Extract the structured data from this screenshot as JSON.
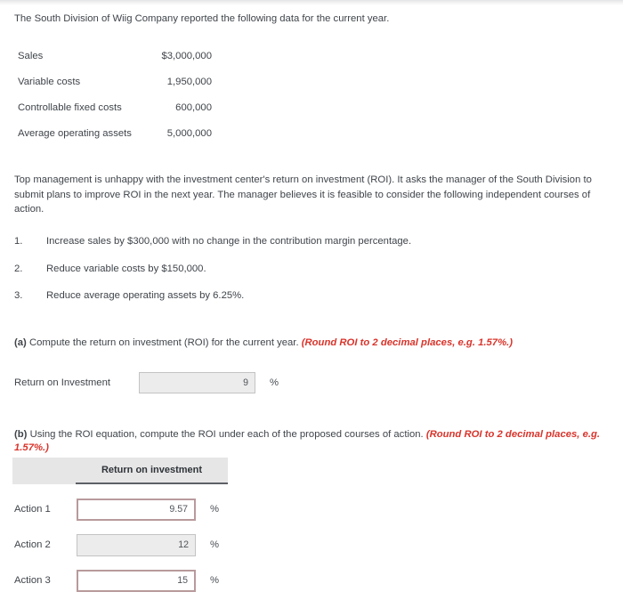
{
  "intro": {
    "text": "The South Division of Wiig Company reported the following data for the current year."
  },
  "financials": {
    "rows": [
      {
        "label": "Sales",
        "value": "$3,000,000"
      },
      {
        "label": "Variable costs",
        "value": "1,950,000"
      },
      {
        "label": "Controllable fixed costs",
        "value": "600,000"
      },
      {
        "label": "Average operating assets",
        "value": "5,000,000"
      }
    ]
  },
  "paragraph": {
    "text": "Top management is unhappy with the investment center's return on investment (ROI). It asks the manager of the South Division to submit plans to improve ROI in the next year. The manager believes it is feasible to consider the following independent courses of action."
  },
  "courses": [
    {
      "number": "1.",
      "text": "Increase sales by $300,000 with no change in the contribution margin percentage."
    },
    {
      "number": "2.",
      "text": "Reduce variable costs by $150,000."
    },
    {
      "number": "3.",
      "text": "Reduce average operating assets by 6.25%."
    }
  ],
  "part_a": {
    "marker": "(a)",
    "question": " Compute the return on investment (ROI) for the current year. ",
    "hint": "(Round ROI to 2 decimal places, e.g. 1.57%.)",
    "answer_label": "Return on Investment",
    "answer_value": "9",
    "percent_symbol": "%"
  },
  "part_b": {
    "marker": "(b)",
    "question": " Using the ROI equation, compute the ROI under each of the proposed courses of action. ",
    "hint": "(Round ROI to 2 decimal places, e.g. 1.57%.)",
    "table": {
      "column_header": "Return on investment",
      "rows": [
        {
          "label": "Action 1",
          "value": "9.57",
          "percent_symbol": "%",
          "state": "active"
        },
        {
          "label": "Action 2",
          "value": "12",
          "percent_symbol": "%",
          "state": "disabled"
        },
        {
          "label": "Action 3",
          "value": "15",
          "percent_symbol": "%",
          "state": "active"
        }
      ]
    }
  },
  "colors": {
    "hint_red": "#d9342b",
    "active_field_border": "#b89a9c",
    "disabled_field_bg": "#ececec",
    "header_bg": "#e6e6e6",
    "text": "#3f444a"
  }
}
